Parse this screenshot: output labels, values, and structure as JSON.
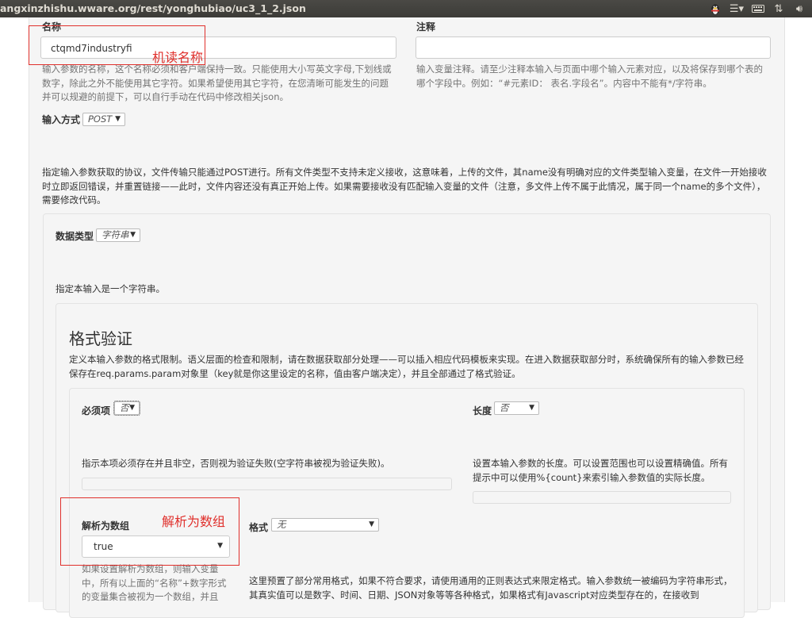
{
  "browser": {
    "url": "angxinzhishu.wware.org/rest/yonghubiao/uc3_1_2.json",
    "indicators": [
      "penguin-icon",
      "menu-icon",
      "keyboard-icon",
      "network-icon",
      "volume-icon"
    ]
  },
  "name_field": {
    "label": "名称",
    "value": "ctqmd7industryfi",
    "help": "输入参数的名称，这个名称必须和客户端保持一致。只能使用大小写英文字母,下划线或数字，除此之外不能使用其它字符。如果希望使用其它字符，在您清晰可能发生的问题并可以规避的前提下，可以自行手动在代码中修改相关json。",
    "annotation": "机读名称"
  },
  "comment_field": {
    "label": "注释",
    "value": "",
    "help": "输入变量注释。请至少注释本输入与页面中哪个输入元素对应，以及将保存到哪个表的哪个字段中。例如：“#元素ID：  表名.字段名”。内容中不能有*/字符串。"
  },
  "input_method": {
    "label": "输入方式",
    "selected": "POST",
    "description": "指定输入参数获取的协议，文件传输只能通过POST进行。所有文件类型不支持未定义接收，这意味着，上传的文件，其name没有明确对应的文件类型输入变量，在文件一开始接收时立即返回错误，并重置链接——此时，文件内容还没有真正开始上传。如果需要接收没有匹配输入变量的文件（注意，多文件上传不属于此情况，属于同一个name的多个文件），需要修改代码。"
  },
  "data_type": {
    "label": "数据类型",
    "selected": "字符串",
    "description": "指定本输入是一个字符串。"
  },
  "format_validation": {
    "heading": "格式验证",
    "description": "定义本输入参数的格式限制。语义层面的检查和限制，请在数据获取部分处理——可以插入相应代码模板来实现。在进入数据获取部分时，系统确保所有的输入参数已经保存在req.params.param对象里（key就是你这里设定的名称，值由客户端决定），并且全部通过了格式验证。",
    "required": {
      "label": "必须项",
      "selected": "否",
      "help": "指示本项必须存在并且非空，否则视为验证失败(空字符串被视为验证失败)。"
    },
    "length": {
      "label": "长度",
      "selected": "否",
      "help": "设置本输入参数的长度。可以设置范围也可以设置精确值。所有提示中可以使用%{count}来索引输入参数值的实际长度。"
    },
    "parse_array": {
      "label": "解析为数组",
      "selected": "true",
      "help": "如果设置解析为数组，则输入变量中，所有以上面的“名称”+数字形式的变量集合被视为一个数组，并且",
      "annotation": "解析为数组"
    },
    "format": {
      "label": "格式",
      "selected": "无",
      "help": "这里预置了部分常用格式，如果不符合要求，请使用通用的正则表达式来限定格式。输入参数统一被编码为字符串形式，其真实值可以是数字、时间、日期、JSON对象等等各种格式，如果格式有Javascript对应类型存在的，在接收到"
    }
  },
  "colors": {
    "annotation_red": "#e0302c",
    "well_bg": "#f5f5f5",
    "topbar_bg": "#3c3b37"
  }
}
